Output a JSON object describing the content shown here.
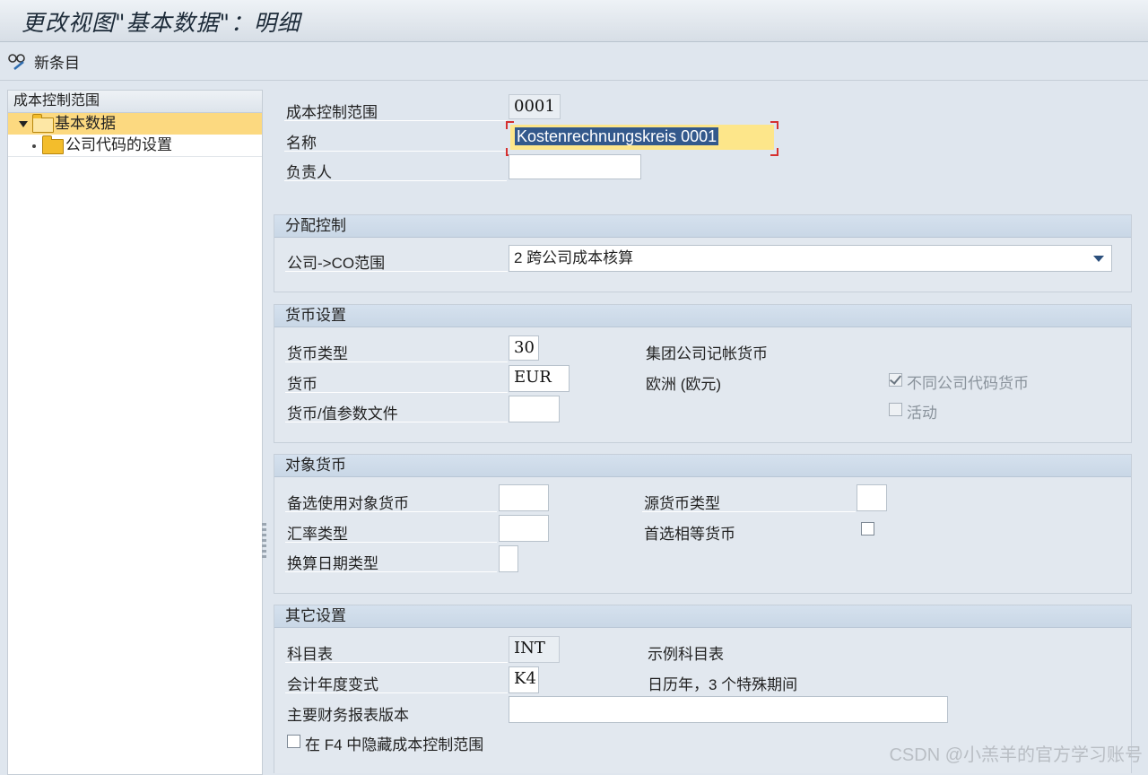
{
  "window": {
    "title": "更改视图\"基本数据\"：明细"
  },
  "toolbar": {
    "new_entries_label": "新条目"
  },
  "nav": {
    "header": "成本控制范围",
    "items": [
      {
        "label": "基本数据"
      },
      {
        "label": "公司代码的设置"
      }
    ]
  },
  "header_fields": {
    "co_area_label": "成本控制范围",
    "co_area_value": "0001",
    "name_label": "名称",
    "name_value": "Kostenrechnungskreis 0001",
    "responsible_label": "负责人",
    "responsible_value": ""
  },
  "assignment": {
    "title": "分配控制",
    "company_co_label": "公司->CO范围",
    "company_co_value": "2 跨公司成本核算"
  },
  "currency": {
    "title": "货币设置",
    "type_label": "货币类型",
    "type_value": "30",
    "type_text": "集团公司记帐货币",
    "currency_label": "货币",
    "currency_value": "EUR",
    "currency_text": "欧洲 (欧元)",
    "profile_label": "货币/值参数文件",
    "profile_value": "",
    "diff_cc_label": "不同公司代码货币",
    "diff_cc_checked": true,
    "active_label": "活动",
    "active_checked": false
  },
  "object_currency": {
    "title": "对象货币",
    "alt_label": "备选使用对象货币",
    "alt_value": "",
    "rate_label": "汇率类型",
    "rate_value": "",
    "date_label": "换算日期类型",
    "date_value": "",
    "source_label": "源货币类型",
    "source_value": "",
    "pref_label": "首选相等货币",
    "pref_checked": false
  },
  "other": {
    "title": "其它设置",
    "coa_label": "科目表",
    "coa_value": "INT",
    "coa_text": "示例科目表",
    "fy_label": "会计年度变式",
    "fy_value": "K4",
    "fy_text": "日历年，3 个特殊期间",
    "fs_label": "主要财务报表版本",
    "fs_value": "",
    "hide_label": "在 F4 中隐藏成本控制范围",
    "hide_checked": false
  },
  "watermark": "CSDN @小羔羊的官方学习账号"
}
